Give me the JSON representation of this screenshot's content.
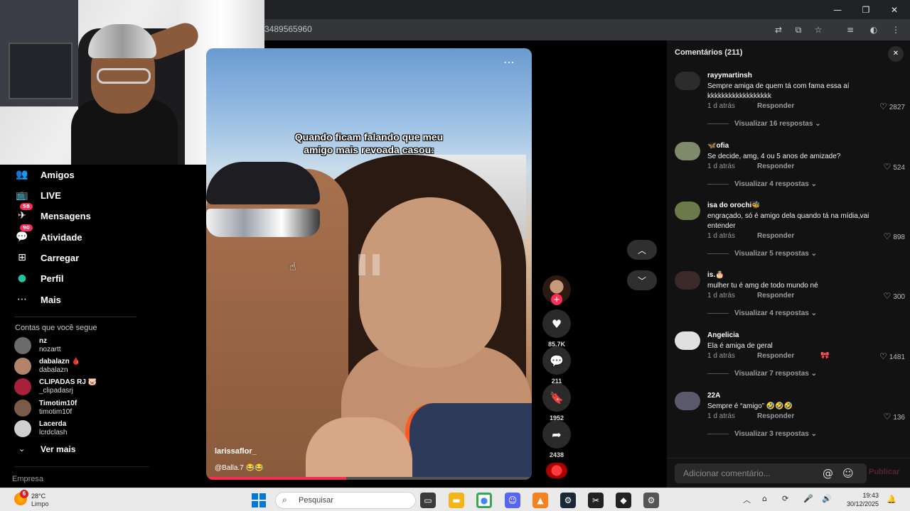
{
  "browser": {
    "url": "3489565960",
    "win_min": "—",
    "win_max": "❐",
    "win_close": "✕"
  },
  "sidebar": {
    "items": [
      {
        "label": "Amigos",
        "icon": "friends-icon",
        "glyph": "👥"
      },
      {
        "label": "LIVE",
        "icon": "live-icon",
        "glyph": "📺"
      },
      {
        "label": "Mensagens",
        "icon": "messages-icon",
        "glyph": "✈",
        "badge": "58"
      },
      {
        "label": "Atividade",
        "icon": "activity-icon",
        "glyph": "💬",
        "badge": "90"
      },
      {
        "label": "Carregar",
        "icon": "upload-icon",
        "glyph": "⊞"
      },
      {
        "label": "Perfil",
        "icon": "profile-icon",
        "glyph": "●"
      },
      {
        "label": "Mais",
        "icon": "more-icon",
        "glyph": "⋯"
      }
    ],
    "following_title": "Contas que você segue",
    "accounts": [
      {
        "name": "nz",
        "user": "nozartt",
        "color": "#6b6b6b"
      },
      {
        "name": "dabalazn 🩸",
        "user": "dabalazn",
        "color": "#b0856b"
      },
      {
        "name": "CLIPADAS RJ 🐷",
        "user": "_clipadasrj",
        "color": "#a8203a"
      },
      {
        "name": "Timotim10f",
        "user": "timotim10f",
        "color": "#7a5a48"
      },
      {
        "name": "Lacerda",
        "user": "lcrdclash",
        "color": "#cfcfcf"
      }
    ],
    "see_more": "Ver mais",
    "see_more_icon": "⌄",
    "company": "Empresa"
  },
  "video": {
    "caption_line1": "Quando ficam falando que meu",
    "caption_line2": "amigo mais revoada casou:",
    "more": "⋯",
    "author": "larissaflor_",
    "description": "@Balla.7 😂😂",
    "progress": 0.43
  },
  "actions": {
    "follow_plus": "+",
    "like": {
      "glyph": "♥",
      "count": "85.7K"
    },
    "comment": {
      "glyph": "💬",
      "count": "211"
    },
    "save": {
      "glyph": "🔖",
      "count": "1952"
    },
    "share": {
      "glyph": "➦",
      "count": "2438"
    }
  },
  "nav": {
    "up": "︿",
    "down": "﹀"
  },
  "comments": {
    "title": "Comentários (211)",
    "close": "✕",
    "reply_label": "Responder",
    "items": [
      {
        "user": "rayymartinsh",
        "text": "Sempre amiga de quem tá com fama essa aí kkkkkkkkkkkkkkkkkk",
        "time": "1 d atrás",
        "likes": "2827",
        "replies": "Visualizar 16 respostas ⌄",
        "av": "#2c2c2c"
      },
      {
        "user": "🦋ofia",
        "text": "Se decide, amg, 4 ou 5 anos de amizade?",
        "time": "1 d atrás",
        "likes": "524",
        "replies": "Visualizar 4 respostas ⌄",
        "av": "#7d8b6a"
      },
      {
        "user": "isa do orochi🐝",
        "text": "engraçado, só é amigo dela quando tá na mídia,vai entender",
        "time": "1 d atrás",
        "likes": "898",
        "replies": "Visualizar 5 respostas ⌄",
        "av": "#6b7a4a"
      },
      {
        "user": "is.🎂",
        "text": "mulher tu é amg de todo mundo né",
        "time": "1 d atrás",
        "likes": "300",
        "replies": "Visualizar 4 respostas ⌄",
        "av": "#3a2a2a"
      },
      {
        "user": "Angelicia",
        "text": "Ela é amiga de geral",
        "time": "1 d atrás",
        "likes": "1481",
        "replies": "Visualizar 7 respostas ⌄",
        "av": "#e0e0e0",
        "extra": "🎀"
      },
      {
        "user": "22A",
        "text": "Sempre é “amigo” 🤣🤣🤣",
        "time": "1 d atrás",
        "likes": "136",
        "replies": "Visualizar 3 respostas ⌄",
        "av": "#5a5a6a"
      }
    ],
    "input_placeholder": "Adicionar comentário...",
    "mention_icon": "@",
    "emoji_icon": "☺",
    "post_label": "Publicar"
  },
  "taskbar": {
    "weather_badge": "6",
    "temp": "28°C",
    "weather": "Limpo",
    "search_placeholder": "Pesquisar",
    "search_icon": "⌕",
    "time": "19:43",
    "date": "30/12/2025"
  }
}
